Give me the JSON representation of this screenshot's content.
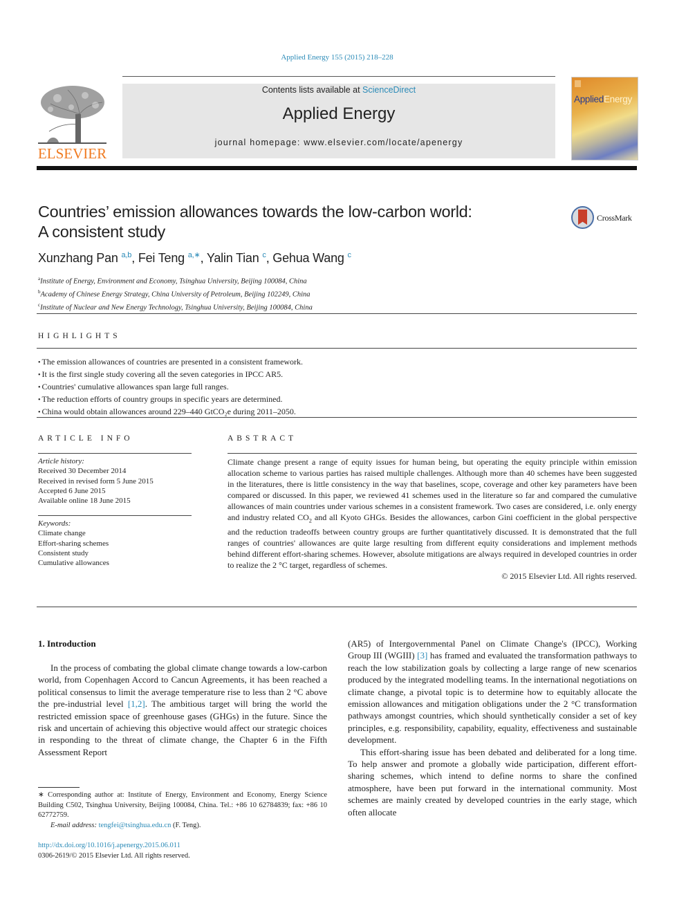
{
  "journal_citation": "Applied Energy 155 (2015) 218–228",
  "masthead": {
    "contents_prefix": "Contents lists available at ",
    "contents_link": "ScienceDirect",
    "journal_title": "Applied Energy",
    "homepage": "journal homepage: www.elsevier.com/locate/apenergy",
    "publisher_logo_text": "ELSEVIER",
    "cover_title_a": "Applied",
    "cover_title_b": "Energy"
  },
  "crossmark_label": "CrossMark",
  "article": {
    "title_line1": "Countries’ emission allowances towards the low-carbon world:",
    "title_line2": "A consistent study",
    "authors": [
      {
        "name": "Xunzhang Pan",
        "sup": "a,b",
        "sep": ", "
      },
      {
        "name": "Fei Teng",
        "sup": "a,∗",
        "sep": ", "
      },
      {
        "name": "Yalin Tian",
        "sup": "c",
        "sep": ", "
      },
      {
        "name": "Gehua Wang",
        "sup": "c",
        "sep": ""
      }
    ],
    "affiliations": [
      {
        "key": "a",
        "text": "Institute of Energy, Environment and Economy, Tsinghua University, Beijing 100084, China"
      },
      {
        "key": "b",
        "text": "Academy of Chinese Energy Strategy, China University of Petroleum, Beijing 102249, China"
      },
      {
        "key": "c",
        "text": "Institute of Nuclear and New Energy Technology, Tsinghua University, Beijing 100084, China"
      }
    ]
  },
  "highlights": {
    "heading": "HIGHLIGHTS",
    "items": [
      "The emission allowances of countries are presented in a consistent framework.",
      "It is the first single study covering all the seven categories in IPCC AR5.",
      "Countries' cumulative allowances span large full ranges.",
      "The reduction efforts of country groups in specific years are determined.",
      "China would obtain allowances around 229–440 GtCO₂e during 2011–2050."
    ]
  },
  "article_info": {
    "heading": "ARTICLE INFO",
    "history_label": "Article history:",
    "history": [
      "Received 30 December 2014",
      "Received in revised form 5 June 2015",
      "Accepted 6 June 2015",
      "Available online 18 June 2015"
    ],
    "keywords_label": "Keywords:",
    "keywords": [
      "Climate change",
      "Effort-sharing schemes",
      "Consistent study",
      "Cumulative allowances"
    ]
  },
  "abstract": {
    "heading": "ABSTRACT",
    "text_part1": "Climate change present a range of equity issues for human being, but operating the equity principle within emission allocation scheme to various parties has raised multiple challenges. Although more than 40 schemes have been suggested in the literatures, there is little consistency in the way that baselines, scope, coverage and other key parameters have been compared or discussed. In this paper, we reviewed 41 schemes used in the literature so far and compared the cumulative allowances of main countries under various schemes in a consistent framework. Two cases are considered, i.e. only energy and industry related CO",
    "text_sub": "2",
    "text_part2": " and all Kyoto GHGs. Besides the allowances, carbon Gini coefficient in the global perspective and the reduction tradeoffs between country groups are further quantitatively discussed. It is demonstrated that the full ranges of countries' allowances are quite large resulting from different equity considerations and implement methods behind different effort-sharing schemes. However, absolute mitigations are always required in developed countries in order to realize the 2 °C target, regardless of schemes.",
    "copyright": "© 2015 Elsevier Ltd. All rights reserved."
  },
  "introduction": {
    "heading": "1. Introduction",
    "p1_a": "In the process of combating the global climate change towards a low-carbon world, from Copenhagen Accord to Cancun Agreements, it has been reached a political consensus to limit the average temperature rise to less than 2 °C above the pre-industrial level ",
    "p1_ref": "[1,2]",
    "p1_b": ". The ambitious target will bring the world the restricted emission space of greenhouse gases (GHGs) in the future. Since the risk and uncertain of achieving this objective would affect our strategic choices in responding to the threat of climate change, the Chapter 6 in the Fifth Assessment Report",
    "p2_a": "(AR5) of Intergovernmental Panel on Climate Change's (IPCC), Working Group III (WGIII) ",
    "p2_ref": "[3]",
    "p2_b": " has framed and evaluated the transformation pathways to reach the low stabilization goals by collecting a large range of new scenarios produced by the integrated modelling teams. In the international negotiations on climate change, a pivotal topic is to determine how to equitably allocate the emission allowances and mitigation obligations under the 2 °C transformation pathways amongst countries, which should synthetically consider a set of key principles, e.g. responsibility, capability, equality, effectiveness and sustainable development.",
    "p3": "This effort-sharing issue has been debated and deliberated for a long time. To help answer and promote a globally wide participation, different effort-sharing schemes, which intend to define norms to share the confined atmosphere, have been put forward in the international community. Most schemes are mainly created by developed countries in the early stage, which often allocate"
  },
  "footnote": {
    "corresponding": "∗ Corresponding author at: Institute of Energy, Environment and Economy, Energy Science Building C502, Tsinghua University, Beijing 100084, China. Tel.: +86 10 62784839; fax: +86 10 62772759.",
    "email_label": "E-mail address:",
    "email": "tengfei@tsinghua.edu.cn",
    "email_suffix": " (F. Teng)."
  },
  "doi": "http://dx.doi.org/10.1016/j.apenergy.2015.06.011",
  "issn_line": "0306-2619/© 2015 Elsevier Ltd. All rights reserved."
}
